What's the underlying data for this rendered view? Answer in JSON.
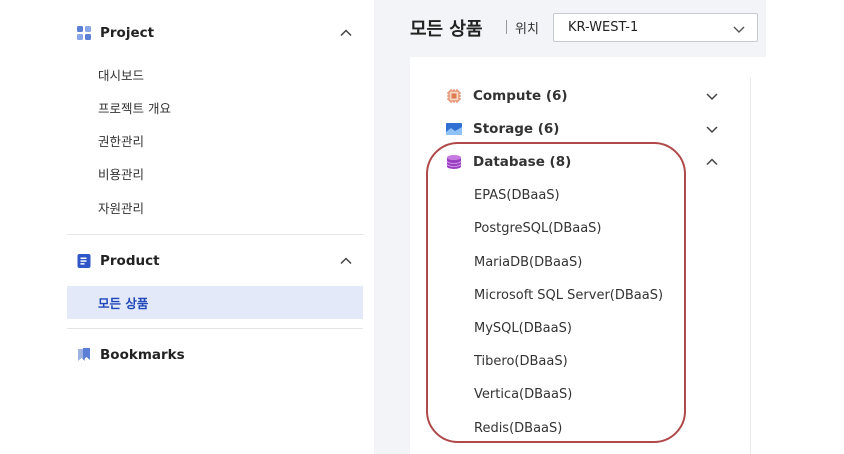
{
  "sidebar": {
    "project": {
      "title": "Project",
      "items": [
        "대시보드",
        "프로젝트 개요",
        "권한관리",
        "비용관리",
        "자원관리"
      ]
    },
    "product": {
      "title": "Product",
      "active_item": "모든 상품"
    },
    "bookmarks": {
      "title": "Bookmarks"
    }
  },
  "header": {
    "title": "모든 상품",
    "location_label": "위치",
    "region_value": "KR-WEST-1"
  },
  "categories": {
    "compute": "Compute (6)",
    "storage": "Storage (6)",
    "database": "Database (8)"
  },
  "database_items": [
    "EPAS(DBaaS)",
    "PostgreSQL(DBaaS)",
    "MariaDB(DBaaS)",
    "Microsoft SQL Server(DBaaS)",
    "MySQL(DBaaS)",
    "Tibero(DBaaS)",
    "Vertica(DBaaS)",
    "Redis(DBaaS)"
  ],
  "colors": {
    "accent": "#1f47b8",
    "active_bg": "#e3e9f8",
    "highlight": "#b04a4a",
    "main_bg": "#f3f4f7"
  },
  "icons": {
    "project": "grid-icon",
    "product": "document-icon",
    "bookmarks": "bookmark-icon",
    "compute": "chip-icon",
    "storage": "storage-icon",
    "database": "database-icon"
  }
}
